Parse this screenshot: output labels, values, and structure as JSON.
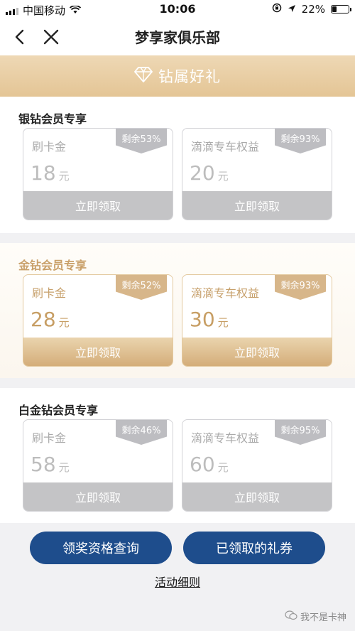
{
  "status_bar": {
    "carrier": "中国移动",
    "time": "10:06",
    "battery": "22%"
  },
  "nav": {
    "title": "梦享家俱乐部"
  },
  "banner": {
    "title": "钻属好礼"
  },
  "sections": [
    {
      "title": "银钻会员专享",
      "cards": [
        {
          "name": "刷卡金",
          "amount": "18",
          "unit": "元",
          "remaining": "剩余53%",
          "button": "立即领取"
        },
        {
          "name": "滴滴专车权益",
          "amount": "20",
          "unit": "元",
          "remaining": "剩余93%",
          "button": "立即领取"
        }
      ]
    },
    {
      "title": "金钻会员专享",
      "cards": [
        {
          "name": "刷卡金",
          "amount": "28",
          "unit": "元",
          "remaining": "剩余52%",
          "button": "立即领取"
        },
        {
          "name": "滴滴专车权益",
          "amount": "30",
          "unit": "元",
          "remaining": "剩余93%",
          "button": "立即领取"
        }
      ]
    },
    {
      "title": "白金钻会员专享",
      "cards": [
        {
          "name": "刷卡金",
          "amount": "58",
          "unit": "元",
          "remaining": "剩余46%",
          "button": "立即领取"
        },
        {
          "name": "滴滴专车权益",
          "amount": "60",
          "unit": "元",
          "remaining": "剩余95%",
          "button": "立即领取"
        }
      ]
    }
  ],
  "bottom": {
    "query_button": "领奖资格查询",
    "coupons_button": "已领取的礼券",
    "rules_link": "活动细则"
  },
  "watermark": "我不是卡神",
  "colors": {
    "gold": "#d4ad79",
    "silver": "#c4c4c6",
    "navy": "#1e4d8c"
  }
}
